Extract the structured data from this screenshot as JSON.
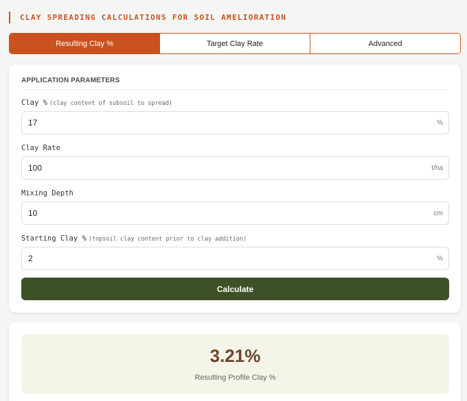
{
  "header": {
    "title": "CLAY SPREADING CALCULATIONS FOR SOIL AMELIORATION"
  },
  "tabs": [
    {
      "label": "Resulting Clay %",
      "active": true
    },
    {
      "label": "Target Clay Rate",
      "active": false
    },
    {
      "label": "Advanced",
      "active": false
    }
  ],
  "params": {
    "section_title": "APPLICATION PARAMETERS",
    "fields": [
      {
        "label": "Clay %",
        "hint": "(clay content of subsoil to spread)",
        "value": "17",
        "unit": "%"
      },
      {
        "label": "Clay Rate",
        "hint": "",
        "value": "100",
        "unit": "t/ha"
      },
      {
        "label": "Mixing Depth",
        "hint": "",
        "value": "10",
        "unit": "cm"
      },
      {
        "label": "Starting Clay %",
        "hint": "(topsoil clay content prior to clay addition)",
        "value": "2",
        "unit": "%"
      }
    ],
    "calculate_label": "Calculate"
  },
  "result": {
    "value": "3.21%",
    "label": "Resulting Profile Clay %"
  },
  "colors": {
    "accent": "#c8531f",
    "button": "#3e5027",
    "result_bg": "#f4f4e8",
    "result_value": "#6b4529"
  }
}
